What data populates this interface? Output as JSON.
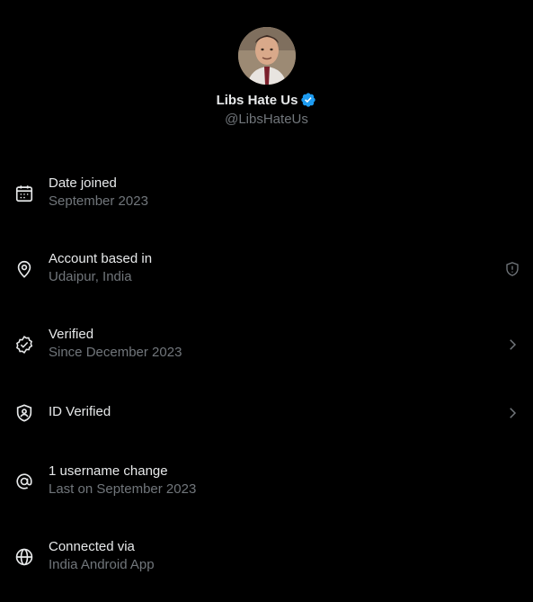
{
  "profile": {
    "display_name": "Libs Hate Us",
    "handle": "@LibsHateUs",
    "verified_badge_color": "#1d9bf0"
  },
  "rows": [
    {
      "icon": "calendar-icon",
      "title": "Date joined",
      "subtitle": "September 2023",
      "trailing": null
    },
    {
      "icon": "location-pin-icon",
      "title": "Account based in",
      "subtitle": "Udaipur, India",
      "trailing": "shield-alert-icon"
    },
    {
      "icon": "verified-check-icon",
      "title": "Verified",
      "subtitle": "Since December 2023",
      "trailing": "chevron-right-icon"
    },
    {
      "icon": "id-shield-icon",
      "title": "ID Verified",
      "subtitle": "",
      "trailing": "chevron-right-icon"
    },
    {
      "icon": "at-sign-icon",
      "title": "1 username change",
      "subtitle": "Last on September 2023",
      "trailing": null
    },
    {
      "icon": "globe-icon",
      "title": "Connected via",
      "subtitle": "India Android App",
      "trailing": null
    }
  ],
  "colors": {
    "background": "#000000",
    "primary_text": "#e7e9ea",
    "secondary_text": "#71767b",
    "accent": "#1d9bf0"
  }
}
